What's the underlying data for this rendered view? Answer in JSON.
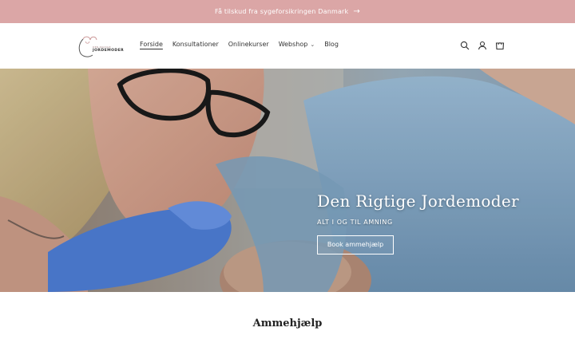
{
  "announcement": {
    "text": "Få tilskud fra sygeforsikringen Danmark",
    "arrow_icon": "arrow-right-icon",
    "background": "#dba6a6"
  },
  "header": {
    "logo": {
      "sub": "DEN RIGTIGE",
      "text": "JORDEMODER"
    },
    "nav": [
      {
        "label": "Forside",
        "active": true
      },
      {
        "label": "Konsultationer",
        "active": false
      },
      {
        "label": "Onlinekurser",
        "active": false
      },
      {
        "label": "Webshop",
        "active": false,
        "has_dropdown": true
      },
      {
        "label": "Blog",
        "active": false
      }
    ],
    "icons": [
      "search-icon",
      "account-icon",
      "cart-icon"
    ]
  },
  "hero": {
    "title": "Den Rigtige Jordemoder",
    "subtitle": "ALT I OG TIL AMNING",
    "button_label": "Book ammehjælp"
  },
  "section": {
    "title": "Ammehjælp"
  }
}
